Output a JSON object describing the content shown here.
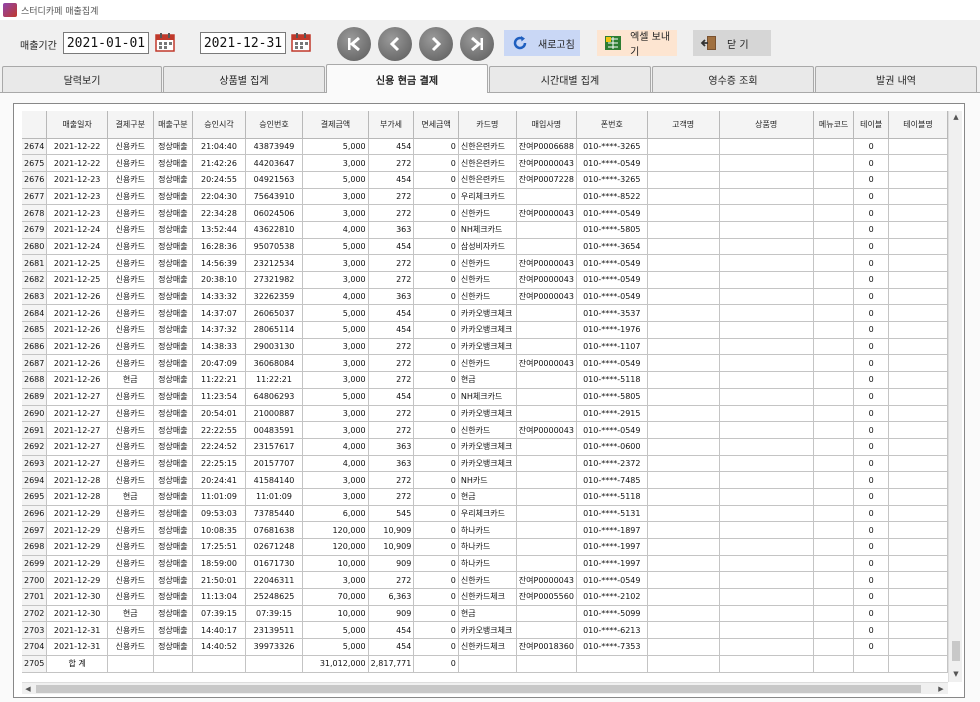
{
  "window": {
    "title": "스터디카페 매출집계"
  },
  "toolbar": {
    "period_label": "매출기간",
    "start_date": "2021-01-01",
    "end_date": "2021-12-31",
    "refresh_label": "새로고침",
    "excel_label": "엑셀 보내기",
    "close_label": "닫  기"
  },
  "tabs": [
    "달력보기",
    "상품별 집계",
    "신용 현금 결제",
    "시간대별 집계",
    "영수증 조회",
    "발권 내역"
  ],
  "active_tab": 2,
  "table": {
    "columns": [
      "",
      "매출일자",
      "결제구분",
      "매출구분",
      "승인시각",
      "승인번호",
      "결제금액",
      "부가세",
      "면세금액",
      "카드명",
      "매입사명",
      "폰번호",
      "고객명",
      "상품명",
      "메뉴코드",
      "테이블",
      "테이블명"
    ],
    "rows": [
      [
        "2674",
        "2021-12-22",
        "신용카드",
        "정상매출",
        "21:04:40",
        "43873949",
        "5,000",
        "454",
        "0",
        "신한은련카드",
        "잔여P0006688",
        "010-****-3265",
        "",
        "",
        "",
        "0",
        ""
      ],
      [
        "2675",
        "2021-12-22",
        "신용카드",
        "정상매출",
        "21:42:26",
        "44203647",
        "3,000",
        "272",
        "0",
        "신한은련카드",
        "잔여P0000043",
        "010-****-0549",
        "",
        "",
        "",
        "0",
        ""
      ],
      [
        "2676",
        "2021-12-23",
        "신용카드",
        "정상매출",
        "20:24:55",
        "04921563",
        "5,000",
        "454",
        "0",
        "신한은련카드",
        "잔여P0007228",
        "010-****-3265",
        "",
        "",
        "",
        "0",
        ""
      ],
      [
        "2677",
        "2021-12-23",
        "신용카드",
        "정상매출",
        "22:04:30",
        "75643910",
        "3,000",
        "272",
        "0",
        "우리체크카드",
        "",
        "010-****-8522",
        "",
        "",
        "",
        "0",
        ""
      ],
      [
        "2678",
        "2021-12-23",
        "신용카드",
        "정상매출",
        "22:34:28",
        "06024506",
        "3,000",
        "272",
        "0",
        "신한카드",
        "잔여P0000043",
        "010-****-0549",
        "",
        "",
        "",
        "0",
        ""
      ],
      [
        "2679",
        "2021-12-24",
        "신용카드",
        "정상매출",
        "13:52:44",
        "43622810",
        "4,000",
        "363",
        "0",
        "NH체크카드",
        "",
        "010-****-5805",
        "",
        "",
        "",
        "0",
        ""
      ],
      [
        "2680",
        "2021-12-24",
        "신용카드",
        "정상매출",
        "16:28:36",
        "95070538",
        "5,000",
        "454",
        "0",
        "삼성비자카드",
        "",
        "010-****-3654",
        "",
        "",
        "",
        "0",
        ""
      ],
      [
        "2681",
        "2021-12-25",
        "신용카드",
        "정상매출",
        "14:56:39",
        "23212534",
        "3,000",
        "272",
        "0",
        "신한카드",
        "잔여P0000043",
        "010-****-0549",
        "",
        "",
        "",
        "0",
        ""
      ],
      [
        "2682",
        "2021-12-25",
        "신용카드",
        "정상매출",
        "20:38:10",
        "27321982",
        "3,000",
        "272",
        "0",
        "신한카드",
        "잔여P0000043",
        "010-****-0549",
        "",
        "",
        "",
        "0",
        ""
      ],
      [
        "2683",
        "2021-12-26",
        "신용카드",
        "정상매출",
        "14:33:32",
        "32262359",
        "4,000",
        "363",
        "0",
        "신한카드",
        "잔여P0000043",
        "010-****-0549",
        "",
        "",
        "",
        "0",
        ""
      ],
      [
        "2684",
        "2021-12-26",
        "신용카드",
        "정상매출",
        "14:37:07",
        "26065037",
        "5,000",
        "454",
        "0",
        "카카오뱅크체크",
        "",
        "010-****-3537",
        "",
        "",
        "",
        "0",
        ""
      ],
      [
        "2685",
        "2021-12-26",
        "신용카드",
        "정상매출",
        "14:37:32",
        "28065114",
        "5,000",
        "454",
        "0",
        "카카오뱅크체크",
        "",
        "010-****-1976",
        "",
        "",
        "",
        "0",
        ""
      ],
      [
        "2686",
        "2021-12-26",
        "신용카드",
        "정상매출",
        "14:38:33",
        "29003130",
        "3,000",
        "272",
        "0",
        "카카오뱅크체크",
        "",
        "010-****-1107",
        "",
        "",
        "",
        "0",
        ""
      ],
      [
        "2687",
        "2021-12-26",
        "신용카드",
        "정상매출",
        "20:47:09",
        "36068084",
        "3,000",
        "272",
        "0",
        "신한카드",
        "잔여P0000043",
        "010-****-0549",
        "",
        "",
        "",
        "0",
        ""
      ],
      [
        "2688",
        "2021-12-26",
        "현금",
        "정상매출",
        "11:22:21",
        "11:22:21",
        "3,000",
        "272",
        "0",
        "현금",
        "",
        "010-****-5118",
        "",
        "",
        "",
        "0",
        ""
      ],
      [
        "2689",
        "2021-12-27",
        "신용카드",
        "정상매출",
        "11:23:54",
        "64806293",
        "5,000",
        "454",
        "0",
        "NH체크카드",
        "",
        "010-****-5805",
        "",
        "",
        "",
        "0",
        ""
      ],
      [
        "2690",
        "2021-12-27",
        "신용카드",
        "정상매출",
        "20:54:01",
        "21000887",
        "3,000",
        "272",
        "0",
        "카카오뱅크체크",
        "",
        "010-****-2915",
        "",
        "",
        "",
        "0",
        ""
      ],
      [
        "2691",
        "2021-12-27",
        "신용카드",
        "정상매출",
        "22:22:55",
        "00483591",
        "3,000",
        "272",
        "0",
        "신한카드",
        "잔여P0000043",
        "010-****-0549",
        "",
        "",
        "",
        "0",
        ""
      ],
      [
        "2692",
        "2021-12-27",
        "신용카드",
        "정상매출",
        "22:24:52",
        "23157617",
        "4,000",
        "363",
        "0",
        "카카오뱅크체크",
        "",
        "010-****-0600",
        "",
        "",
        "",
        "0",
        ""
      ],
      [
        "2693",
        "2021-12-27",
        "신용카드",
        "정상매출",
        "22:25:15",
        "20157707",
        "4,000",
        "363",
        "0",
        "카카오뱅크체크",
        "",
        "010-****-2372",
        "",
        "",
        "",
        "0",
        ""
      ],
      [
        "2694",
        "2021-12-28",
        "신용카드",
        "정상매출",
        "20:24:41",
        "41584140",
        "3,000",
        "272",
        "0",
        "NH카드",
        "",
        "010-****-7485",
        "",
        "",
        "",
        "0",
        ""
      ],
      [
        "2695",
        "2021-12-28",
        "현금",
        "정상매출",
        "11:01:09",
        "11:01:09",
        "3,000",
        "272",
        "0",
        "현금",
        "",
        "010-****-5118",
        "",
        "",
        "",
        "0",
        ""
      ],
      [
        "2696",
        "2021-12-29",
        "신용카드",
        "정상매출",
        "09:53:03",
        "73785440",
        "6,000",
        "545",
        "0",
        "우리체크카드",
        "",
        "010-****-5131",
        "",
        "",
        "",
        "0",
        ""
      ],
      [
        "2697",
        "2021-12-29",
        "신용카드",
        "정상매출",
        "10:08:35",
        "07681638",
        "120,000",
        "10,909",
        "0",
        "하나카드",
        "",
        "010-****-1897",
        "",
        "",
        "",
        "0",
        ""
      ],
      [
        "2698",
        "2021-12-29",
        "신용카드",
        "정상매출",
        "17:25:51",
        "02671248",
        "120,000",
        "10,909",
        "0",
        "하나카드",
        "",
        "010-****-1997",
        "",
        "",
        "",
        "0",
        ""
      ],
      [
        "2699",
        "2021-12-29",
        "신용카드",
        "정상매출",
        "18:59:00",
        "01671730",
        "10,000",
        "909",
        "0",
        "하나카드",
        "",
        "010-****-1997",
        "",
        "",
        "",
        "0",
        ""
      ],
      [
        "2700",
        "2021-12-29",
        "신용카드",
        "정상매출",
        "21:50:01",
        "22046311",
        "3,000",
        "272",
        "0",
        "신한카드",
        "잔여P0000043",
        "010-****-0549",
        "",
        "",
        "",
        "0",
        ""
      ],
      [
        "2701",
        "2021-12-30",
        "신용카드",
        "정상매출",
        "11:13:04",
        "25248625",
        "70,000",
        "6,363",
        "0",
        "신한카드체크",
        "잔여P0005560",
        "010-****-2102",
        "",
        "",
        "",
        "0",
        ""
      ],
      [
        "2702",
        "2021-12-30",
        "현금",
        "정상매출",
        "07:39:15",
        "07:39:15",
        "10,000",
        "909",
        "0",
        "현금",
        "",
        "010-****-5099",
        "",
        "",
        "",
        "0",
        ""
      ],
      [
        "2703",
        "2021-12-31",
        "신용카드",
        "정상매출",
        "14:40:17",
        "23139511",
        "5,000",
        "454",
        "0",
        "카카오뱅크체크",
        "",
        "010-****-6213",
        "",
        "",
        "",
        "0",
        ""
      ],
      [
        "2704",
        "2021-12-31",
        "신용카드",
        "정상매출",
        "14:40:52",
        "39973326",
        "5,000",
        "454",
        "0",
        "신한카드체크",
        "잔여P0018360",
        "010-****-7353",
        "",
        "",
        "",
        "0",
        ""
      ]
    ],
    "total_row": [
      "2705",
      "합    계",
      "",
      "",
      "",
      "",
      "31,012,000",
      "2,817,771",
      "0",
      "",
      "",
      "",
      "",
      "",
      "",
      "",
      ""
    ]
  }
}
